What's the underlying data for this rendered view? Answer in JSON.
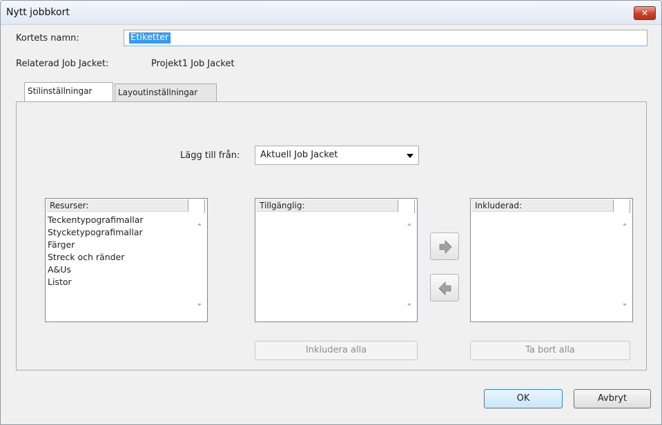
{
  "window": {
    "title": "Nytt jobbkort",
    "close_glyph": "✕"
  },
  "name_field": {
    "label": "Kortets namn:",
    "value": "Etiketter"
  },
  "related": {
    "label": "Relaterad Job Jacket:",
    "value": "Projekt1 Job Jacket"
  },
  "tabs": [
    {
      "label": "Stilinställningar",
      "active": true
    },
    {
      "label": "Layoutinställningar",
      "active": false
    }
  ],
  "add_from": {
    "label": "Lägg till från:",
    "value": "Aktuell Job Jacket"
  },
  "resources": {
    "header": "Resurser:",
    "items": [
      "Teckentypografimallar",
      "Stycketypografimallar",
      "Färger",
      "Streck och ränder",
      "A&Us",
      "Listor"
    ]
  },
  "available": {
    "header": "Tillgänglig:"
  },
  "included": {
    "header": "Inkluderad:"
  },
  "buttons": {
    "include_all": "Inkludera alla",
    "remove_all": "Ta bort alla",
    "ok": "OK",
    "cancel": "Avbryt"
  },
  "icons": {
    "add": "right-arrow-icon",
    "remove": "left-arrow-icon",
    "dropdown": "chevron-down-icon"
  },
  "colors": {
    "accent": "#3399ff",
    "close": "#c7412a"
  }
}
